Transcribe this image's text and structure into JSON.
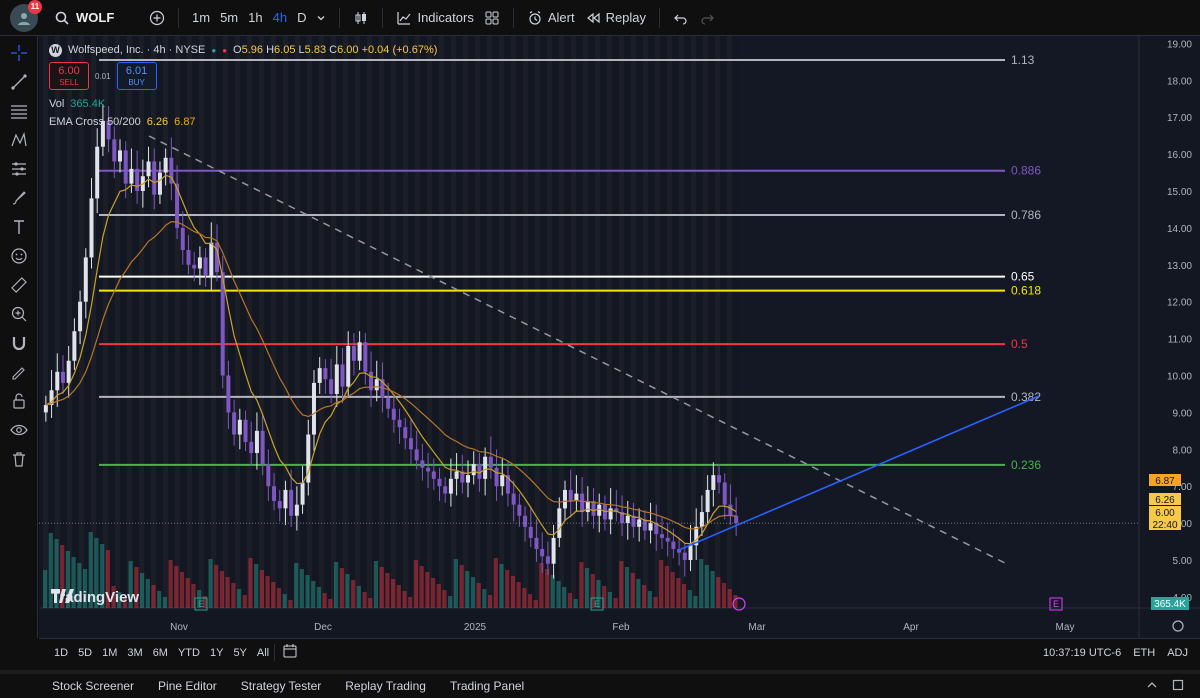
{
  "header": {
    "notifications": "11",
    "symbol": "WOLF",
    "intervals": [
      "1m",
      "5m",
      "1h",
      "4h",
      "D"
    ],
    "active_interval": "4h",
    "indicators_label": "Indicators",
    "alert_label": "Alert",
    "replay_label": "Replay"
  },
  "legend": {
    "title": "Wolfspeed, Inc. · 4h · NYSE",
    "o_label": "O",
    "o": "5.96",
    "h_label": "H",
    "h": "6.05",
    "l_label": "L",
    "l": "5.83",
    "c_label": "C",
    "c": "6.00",
    "change": "+0.04 (+0.67%)",
    "sell_price": "6.00",
    "sell_label": "SELL",
    "spread": "0.01",
    "buy_price": "6.01",
    "buy_label": "BUY",
    "vol_label": "Vol",
    "vol_value": "365.4K",
    "ema_label": "EMA Cross 50/200",
    "ema_fast": "6.26",
    "ema_slow": "6.87"
  },
  "chart_data": {
    "type": "candlestick",
    "y_axis": {
      "ticks": [
        "19.00",
        "18.00",
        "17.00",
        "16.00",
        "15.00",
        "14.00",
        "13.00",
        "12.00",
        "11.00",
        "10.00",
        "9.00",
        "8.00",
        "7.00",
        "6.00",
        "5.00",
        "4.00"
      ],
      "ylim": [
        3.7,
        19.2
      ]
    },
    "x_axis": {
      "ticks": [
        "Nov",
        "Dec",
        "2025",
        "Feb",
        "Mar",
        "Apr",
        "May"
      ]
    },
    "fib_levels": [
      {
        "label": "1.13",
        "price": 18.55,
        "color": "#b2b5be"
      },
      {
        "label": "0.886",
        "price": 15.55,
        "color": "#7e57c2"
      },
      {
        "label": "0.786",
        "price": 14.35,
        "color": "#b2b5be"
      },
      {
        "label": "0.65",
        "price": 12.68,
        "color": "#ffffff"
      },
      {
        "label": "0.618",
        "price": 12.3,
        "color": "#f7e600"
      },
      {
        "label": "0.5",
        "price": 10.85,
        "color": "#f23645"
      },
      {
        "label": "0.382",
        "price": 9.42,
        "color": "#b2b5be"
      },
      {
        "label": "0.236",
        "price": 7.58,
        "color": "#4caf50"
      }
    ],
    "price_labels": [
      {
        "value": "6.87",
        "color": "#f5a623"
      },
      {
        "value": "6.26",
        "color": "#f7c948"
      },
      {
        "value": "6.00",
        "color": "#f7c948"
      },
      {
        "value": "22:40",
        "color": "#f7c948"
      }
    ],
    "volume_label": "365.4K",
    "last_price": 6.0,
    "closes": [
      9.2,
      9.6,
      10.1,
      9.8,
      10.4,
      11.2,
      12.0,
      13.2,
      14.8,
      16.2,
      16.9,
      16.4,
      15.8,
      16.1,
      15.2,
      15.6,
      15.0,
      15.4,
      15.8,
      14.9,
      15.5,
      15.9,
      15.2,
      14.0,
      13.4,
      13.0,
      12.9,
      13.2,
      12.7,
      13.6,
      12.8,
      10.0,
      9.0,
      8.4,
      8.8,
      8.2,
      7.9,
      8.5,
      7.6,
      7.0,
      6.6,
      6.4,
      6.9,
      6.2,
      6.5,
      7.1,
      8.4,
      9.8,
      10.2,
      9.9,
      9.5,
      10.3,
      9.7,
      10.8,
      10.4,
      10.9,
      10.1,
      9.6,
      9.9,
      9.4,
      9.1,
      8.8,
      8.6,
      8.3,
      8.0,
      7.7,
      7.5,
      7.4,
      7.2,
      7.0,
      6.8,
      7.2,
      7.4,
      7.1,
      7.3,
      7.6,
      7.2,
      7.8,
      7.5,
      7.0,
      7.3,
      6.8,
      6.5,
      6.2,
      5.9,
      5.6,
      5.3,
      5.1,
      4.9,
      5.6,
      6.4,
      6.9,
      6.6,
      6.8,
      6.3,
      6.6,
      6.2,
      6.5,
      6.1,
      6.4,
      6.3,
      6.0,
      6.2,
      5.9,
      6.1,
      5.8,
      6.0,
      5.7,
      5.6,
      5.5,
      5.3,
      5.2,
      5.0,
      5.4,
      5.9,
      6.3,
      6.9,
      7.3,
      7.1,
      6.5,
      6.2,
      6.0
    ]
  },
  "timeframes": [
    "1D",
    "5D",
    "1M",
    "3M",
    "6M",
    "YTD",
    "1Y",
    "5Y",
    "All"
  ],
  "status": {
    "time": "10:37:19 UTC-6",
    "session": "ETH",
    "adj": "ADJ"
  },
  "bottom_tabs": [
    "Stock Screener",
    "Pine Editor",
    "Strategy Tester",
    "Replay Trading",
    "Trading Panel"
  ],
  "brand": "TradingView"
}
